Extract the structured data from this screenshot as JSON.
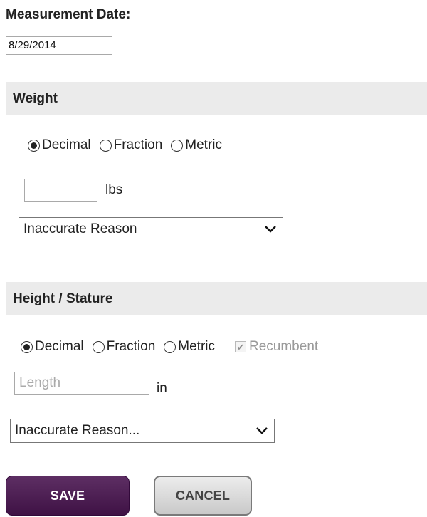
{
  "measurement_date": {
    "label": "Measurement Date:",
    "value": "8/29/2014"
  },
  "weight": {
    "title": "Weight",
    "options": [
      "Decimal",
      "Fraction",
      "Metric"
    ],
    "selected": "Decimal",
    "input_value": "",
    "unit": "lbs",
    "reason_select": "Inaccurate Reason"
  },
  "height": {
    "title": "Height / Stature",
    "options": [
      "Decimal",
      "Fraction",
      "Metric"
    ],
    "selected": "Decimal",
    "recumbent_label": "Recumbent",
    "recumbent_checked": true,
    "input_placeholder": "Length",
    "unit": "in",
    "reason_select": "Inaccurate Reason..."
  },
  "buttons": {
    "save": "SAVE",
    "cancel": "CANCEL"
  },
  "colors": {
    "save_bg": "#4a1a50",
    "header_bg": "#ebebeb"
  }
}
